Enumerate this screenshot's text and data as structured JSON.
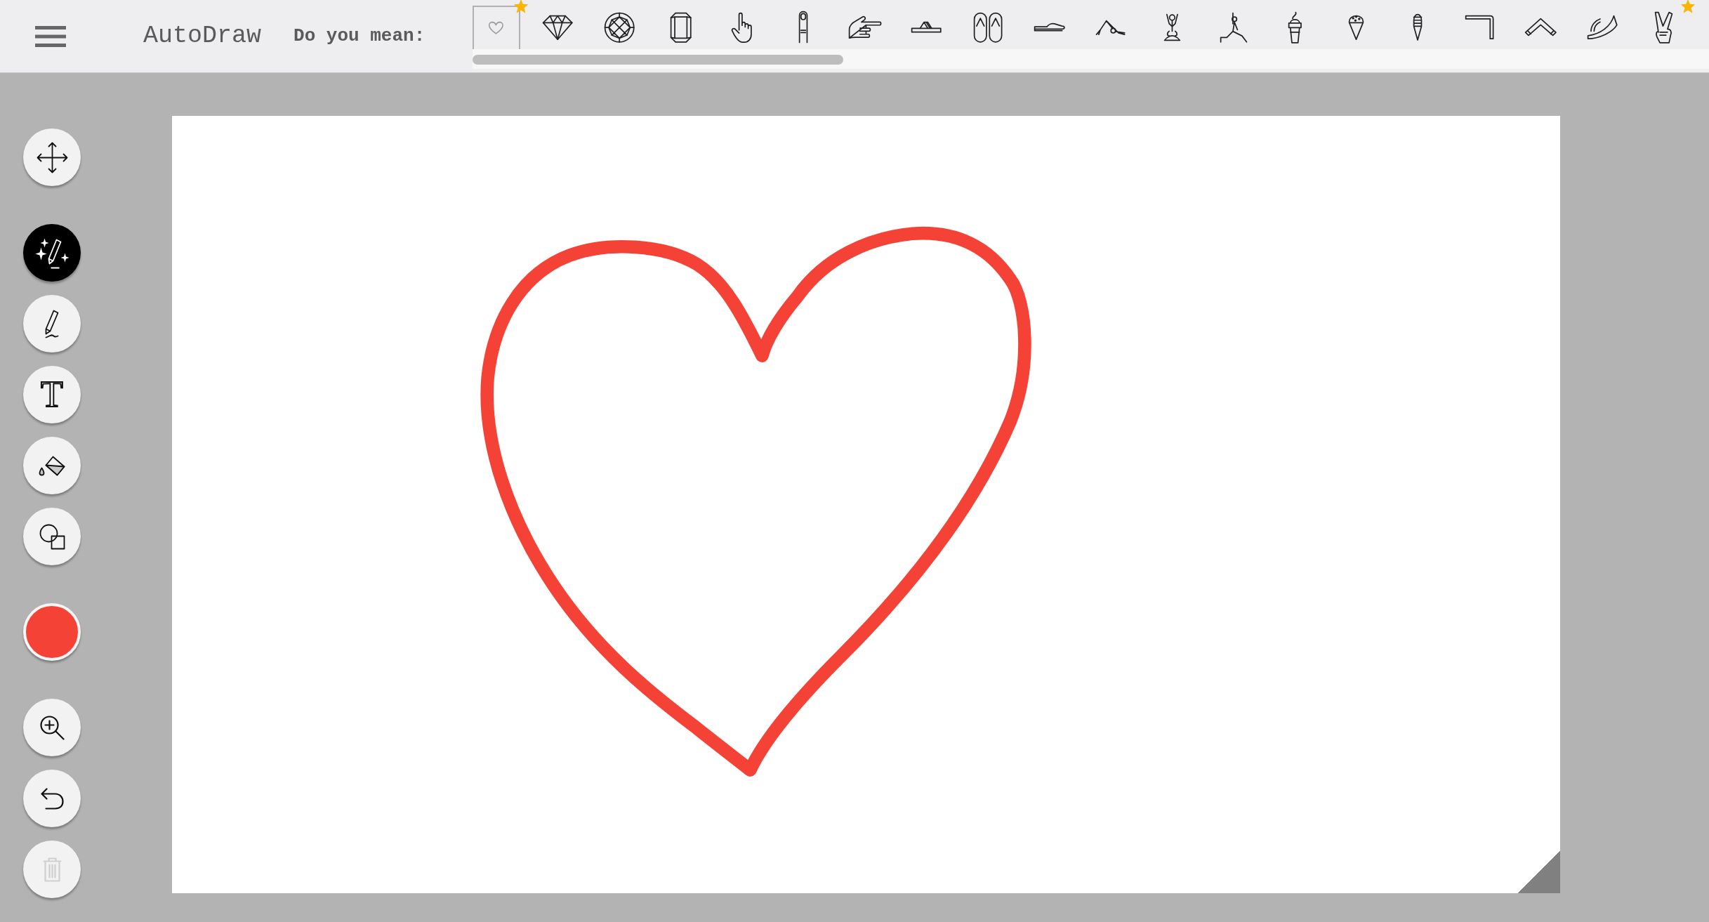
{
  "header": {
    "app_title": "AutoDraw",
    "prompt": "Do you mean:"
  },
  "suggestions": [
    {
      "kind": "heart",
      "selected": true,
      "starred": true
    },
    {
      "kind": "diamond",
      "selected": false,
      "starred": false
    },
    {
      "kind": "round-gem",
      "selected": false,
      "starred": false
    },
    {
      "kind": "emerald-gem",
      "selected": false,
      "starred": false
    },
    {
      "kind": "hand-up",
      "selected": false,
      "starred": false
    },
    {
      "kind": "finger",
      "selected": false,
      "starred": false
    },
    {
      "kind": "hand-side",
      "selected": false,
      "starred": false
    },
    {
      "kind": "sandal",
      "selected": false,
      "starred": false
    },
    {
      "kind": "flip-flops",
      "selected": false,
      "starred": false
    },
    {
      "kind": "shoe",
      "selected": false,
      "starred": false
    },
    {
      "kind": "yoga-bend",
      "selected": false,
      "starred": false
    },
    {
      "kind": "yoga-seated",
      "selected": false,
      "starred": false
    },
    {
      "kind": "yoga-lunge",
      "selected": false,
      "starred": false
    },
    {
      "kind": "sundae-cup",
      "selected": false,
      "starred": false
    },
    {
      "kind": "cone",
      "selected": false,
      "starred": false
    },
    {
      "kind": "tall-cone",
      "selected": false,
      "starred": false
    },
    {
      "kind": "bracket",
      "selected": false,
      "starred": false
    },
    {
      "kind": "chevron",
      "selected": false,
      "starred": false
    },
    {
      "kind": "curved-boomerang",
      "selected": false,
      "starred": false
    },
    {
      "kind": "peace-hand",
      "selected": false,
      "starred": true
    }
  ],
  "tools": [
    {
      "kind": "move",
      "selected": false
    },
    {
      "kind": "autodraw",
      "selected": true
    },
    {
      "kind": "draw",
      "selected": false
    },
    {
      "kind": "type",
      "selected": false,
      "glyph": "T"
    },
    {
      "kind": "fill",
      "selected": false
    },
    {
      "kind": "shape",
      "selected": false
    }
  ],
  "color": "#f44336",
  "actions": [
    {
      "kind": "zoom",
      "disabled": false
    },
    {
      "kind": "undo",
      "disabled": false
    },
    {
      "kind": "delete",
      "disabled": true
    }
  ]
}
